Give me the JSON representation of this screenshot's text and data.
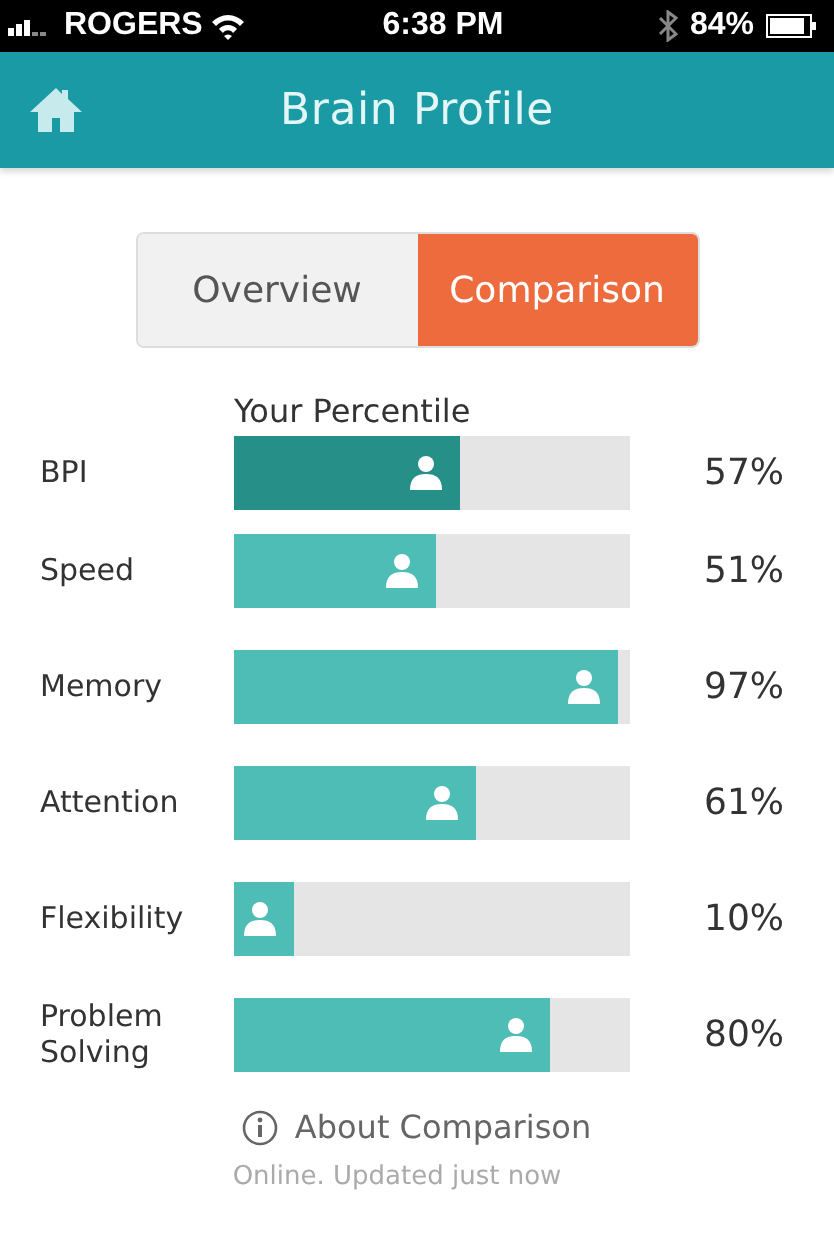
{
  "status_bar": {
    "carrier": "ROGERS",
    "time": "6:38 PM",
    "battery": "84%"
  },
  "header": {
    "title": "Brain Profile"
  },
  "tabs": [
    {
      "label": "Overview",
      "selected": false
    },
    {
      "label": "Comparison",
      "selected": true
    }
  ],
  "chart_heading": "Your Percentile",
  "scores": [
    {
      "name": "BPI",
      "level": 0.57,
      "reading": "57%",
      "color": "#268f87"
    },
    {
      "name": "Speed",
      "level": 0.51,
      "reading": "51%",
      "color": "#4dbdb5"
    },
    {
      "name": "Memory",
      "level": 0.97,
      "reading": "97%",
      "color": "#4dbdb5"
    },
    {
      "name": "Attention",
      "level": 0.61,
      "reading": "61%",
      "color": "#4dbdb5"
    },
    {
      "name": "Flexibility",
      "level": 0.1,
      "reading": "10%",
      "color": "#4dbdb5"
    },
    {
      "name": "Problem Solving",
      "level": 0.8,
      "reading": "80%",
      "color": "#4dbdb5"
    }
  ],
  "about_link": "About Comparison",
  "sync_status": "Online. Updated just now"
}
